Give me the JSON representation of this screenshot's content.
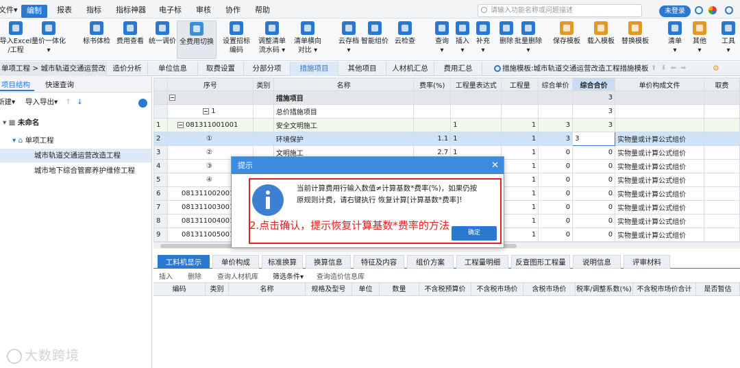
{
  "menubar": {
    "items": [
      "文件▾",
      "编制",
      "报表",
      "指标",
      "指标神器",
      "电子标",
      "审核",
      "协作",
      "帮助"
    ],
    "active_index": 1,
    "search_placeholder": "请输入功能名称或问题描述",
    "login_label": "未登录"
  },
  "toolbar": {
    "buttons": [
      {
        "label": "导入Excel\n/工程",
        "icon": "import-excel-icon"
      },
      {
        "label": "量价一体化\n▾",
        "icon": "quantity-price-icon"
      },
      {
        "label": "标书体检",
        "icon": "bid-check-icon"
      },
      {
        "label": "费用查看",
        "icon": "fee-view-icon"
      },
      {
        "label": "统一调价",
        "icon": "price-adjust-icon"
      },
      {
        "label": "全费用切换",
        "icon": "full-fee-switch-icon"
      },
      {
        "label": "设置招标\n编码",
        "icon": "bid-code-icon"
      },
      {
        "label": "调整清单\n流水码 ▾",
        "icon": "serial-code-icon"
      },
      {
        "label": "清单横向\n对比 ▾",
        "icon": "compare-icon"
      },
      {
        "label": "云存档\n▾",
        "icon": "cloud-archive-icon"
      },
      {
        "label": "智能组价",
        "icon": "smart-price-icon"
      },
      {
        "label": "云检查",
        "icon": "cloud-check-icon"
      },
      {
        "label": "查询\n▾",
        "icon": "query-icon"
      },
      {
        "label": "插入\n▾",
        "icon": "insert-icon"
      },
      {
        "label": "补充\n▾",
        "icon": "supplement-icon"
      },
      {
        "label": "删除",
        "icon": "delete-icon"
      },
      {
        "label": "批量删除\n▾",
        "icon": "batch-delete-icon"
      },
      {
        "label": "保存模板",
        "icon": "save-template-icon"
      },
      {
        "label": "载入模板",
        "icon": "load-template-icon"
      },
      {
        "label": "替换模板",
        "icon": "replace-template-icon"
      },
      {
        "label": "清单\n▾",
        "icon": "list-icon"
      },
      {
        "label": "其他\n▾",
        "icon": "other-icon"
      },
      {
        "label": "工具\n▾",
        "icon": "tools-icon"
      }
    ]
  },
  "tabrow": {
    "breadcrumb": "单项工程 > 城市轨道交通运营改",
    "tabs": [
      "造价分析",
      "单位信息",
      "取费设置",
      "分部分项",
      "措施项目",
      "其他项目",
      "人材机汇总",
      "费用汇总"
    ],
    "active_tab": "措施项目",
    "template_label": "措施模板:城市轨道交通运营改造工程措施模板"
  },
  "left": {
    "tabs": [
      "项目结构",
      "快速查询"
    ],
    "new_label": "新建▾",
    "import_export_label": "导入导出▾",
    "tree": [
      {
        "label": "未命名",
        "level": 0
      },
      {
        "label": "单项工程",
        "level": 1
      },
      {
        "label": "城市轨道交通运营改造工程",
        "level": 2
      },
      {
        "label": "城市地下综合管廊养护维修工程",
        "level": 2
      }
    ]
  },
  "grid": {
    "columns": [
      "",
      "序号",
      "类别",
      "名称",
      "费率(%)",
      "工程量表达式",
      "工程量",
      "综合单价",
      "综合合价",
      "单价构成文件",
      "取费"
    ],
    "rows": [
      {
        "idx": "",
        "seq": "措施项目",
        "cat": "",
        "name": "措施项目",
        "rate": "",
        "expr": "",
        "qty": "",
        "unit": "",
        "total": "3",
        "file": "",
        "style": "gray"
      },
      {
        "idx": "",
        "seq": "1",
        "cat": "",
        "name": "总价措施项目",
        "rate": "",
        "expr": "",
        "qty": "",
        "unit": "",
        "total": "3",
        "file": "",
        "style": "plain"
      },
      {
        "idx": "1",
        "seq": "081311001001",
        "cat": "",
        "name": "安全文明施工",
        "rate": "",
        "expr": "1",
        "qty": "1",
        "unit": "3",
        "total": "3",
        "file": "",
        "style": "light"
      },
      {
        "idx": "2",
        "seq": "①",
        "cat": "",
        "name": "环境保护",
        "rate": "1.1",
        "expr": "1",
        "qty": "1",
        "unit": "3",
        "total": "3",
        "file": "实物量或计算公式组价",
        "style": "sel"
      },
      {
        "idx": "3",
        "seq": "②",
        "cat": "",
        "name": "文明施工",
        "rate": "2.7",
        "expr": "1",
        "qty": "1",
        "unit": "0",
        "total": "0",
        "file": "实物量或计算公式组价",
        "style": "plain"
      },
      {
        "idx": "4",
        "seq": "③",
        "cat": "",
        "name": "",
        "rate": "",
        "expr": "",
        "qty": "1",
        "unit": "0",
        "total": "0",
        "file": "实物量或计算公式组价",
        "style": "plain"
      },
      {
        "idx": "5",
        "seq": "④",
        "cat": "",
        "name": "",
        "rate": "",
        "expr": "",
        "qty": "1",
        "unit": "0",
        "total": "0",
        "file": "实物量或计算公式组价",
        "style": "plain"
      },
      {
        "idx": "6",
        "seq": "081311002001",
        "cat": "",
        "name": "",
        "rate": "",
        "expr": "",
        "qty": "1",
        "unit": "0",
        "total": "0",
        "file": "实物量或计算公式组价",
        "style": "plain"
      },
      {
        "idx": "7",
        "seq": "081311003001",
        "cat": "",
        "name": "",
        "rate": "",
        "expr": "",
        "qty": "1",
        "unit": "0",
        "total": "0",
        "file": "实物量或计算公式组价",
        "style": "plain"
      },
      {
        "idx": "8",
        "seq": "081311004001",
        "cat": "",
        "name": "",
        "rate": "",
        "expr": "",
        "qty": "1",
        "unit": "0",
        "total": "0",
        "file": "实物量或计算公式组价",
        "style": "plain"
      },
      {
        "idx": "9",
        "seq": "081311005001",
        "cat": "",
        "name": "",
        "rate": "",
        "expr": "",
        "qty": "1",
        "unit": "0",
        "total": "0",
        "file": "实物量或计算公式组价",
        "style": "plain"
      }
    ]
  },
  "bottom": {
    "tabs": [
      "工料机显示",
      "单价构成",
      "标准换算",
      "换算信息",
      "特征及内容",
      "组价方案",
      "工程量明细",
      "反查图形工程量",
      "说明信息",
      "评审材料"
    ],
    "active_tab": "工料机显示",
    "subtools": [
      "插入",
      "删除",
      "查询人材机库",
      "筛选条件▾",
      "查询造价信息库"
    ],
    "columns": [
      "编码",
      "类别",
      "名称",
      "规格及型号",
      "单位",
      "数量",
      "不含税预算价",
      "不含税市场价",
      "含税市场价",
      "税率/调整系数(%)",
      "不含税市场价合计",
      "是否暂估"
    ]
  },
  "dialog": {
    "title": "提示",
    "message": "当前计算费用行输入数值≠计算基数*费率(%)，如果仍按原规则计费，请右键执行 恢复计算[计算基数*费率]!",
    "ok_label": "确定",
    "annotation": "2.点击确认，提示恢复计算基数*费率的方法"
  },
  "watermark": "大数跨境"
}
